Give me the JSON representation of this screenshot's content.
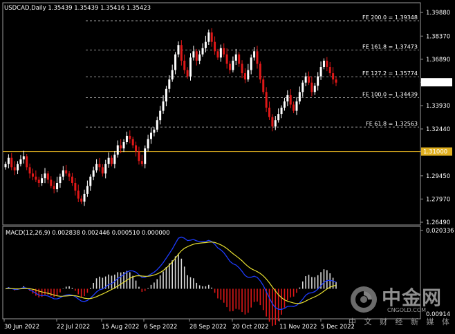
{
  "chart_data": [
    {
      "type": "candlestick",
      "title": "USDCAD,Daily",
      "ohlc_readout": "1.35439 1.35439 1.35416 1.35423",
      "price_axis_ticks": [
        "1.39880",
        "1.38370",
        "1.36890",
        "1.35423",
        "1.33930",
        "1.32440",
        "1.31000",
        "1.29450",
        "1.27970",
        "1.26490"
      ],
      "ylim": [
        1.2649,
        1.3988
      ],
      "current_price": "1.35423",
      "horizontal_line": {
        "label": "1.31000",
        "value": 1.31
      },
      "fibonacci_levels": [
        {
          "label": "FE 200.0 = 1.39348",
          "value": 1.39348
        },
        {
          "label": "FE 161.8 = 1.37473",
          "value": 1.37473
        },
        {
          "label": "FE 127.2 = 1.35774",
          "value": 1.35774
        },
        {
          "label": "FE 100.0 = 1.34439",
          "value": 1.34439
        },
        {
          "label": "FE 61.8 = 1.32563",
          "value": 1.32563
        }
      ],
      "x_tick_labels": [
        "30 Jun 2022",
        "22 Jul 2022",
        "15 Aug 2022",
        "6 Sep 2022",
        "28 Sep 2022",
        "20 Oct 2022",
        "11 Nov 2022",
        "5 Dec 2022"
      ],
      "close_path": [
        1.302,
        1.306,
        1.3,
        1.298,
        1.302,
        1.305,
        1.307,
        1.3,
        1.296,
        1.294,
        1.292,
        1.29,
        1.293,
        1.296,
        1.292,
        1.288,
        1.286,
        1.29,
        1.294,
        1.298,
        1.296,
        1.294,
        1.29,
        1.285,
        1.28,
        1.278,
        1.283,
        1.288,
        1.294,
        1.298,
        1.302,
        1.3,
        1.296,
        1.302,
        1.306,
        1.302,
        1.308,
        1.314,
        1.312,
        1.316,
        1.32,
        1.318,
        1.314,
        1.31,
        1.304,
        1.302,
        1.312,
        1.318,
        1.322,
        1.324,
        1.33,
        1.336,
        1.342,
        1.35,
        1.356,
        1.362,
        1.372,
        1.378,
        1.368,
        1.362,
        1.358,
        1.37,
        1.374,
        1.368,
        1.372,
        1.376,
        1.38,
        1.386,
        1.38,
        1.374,
        1.37,
        1.376,
        1.372,
        1.366,
        1.362,
        1.368,
        1.372,
        1.366,
        1.36,
        1.356,
        1.362,
        1.37,
        1.374,
        1.366,
        1.356,
        1.348,
        1.338,
        1.332,
        1.326,
        1.33,
        1.334,
        1.338,
        1.342,
        1.346,
        1.34,
        1.336,
        1.342,
        1.348,
        1.354,
        1.358,
        1.354,
        1.348,
        1.352,
        1.358,
        1.364,
        1.368,
        1.364,
        1.36,
        1.356,
        1.354
      ]
    },
    {
      "type": "histogram_line",
      "title": "MACD(12,26,9) 0.002838 0.002446 0.000510 0.000000",
      "axis_ticks": [
        "0.020336",
        "0.00914",
        "0.00000"
      ],
      "ylim": [
        -0.0095,
        0.0203
      ]
    }
  ],
  "brand": {
    "name_cn": "中金网",
    "name_en": "CNGOLD.COM",
    "subtitle": "中 文 财 经 新 媒 体"
  }
}
